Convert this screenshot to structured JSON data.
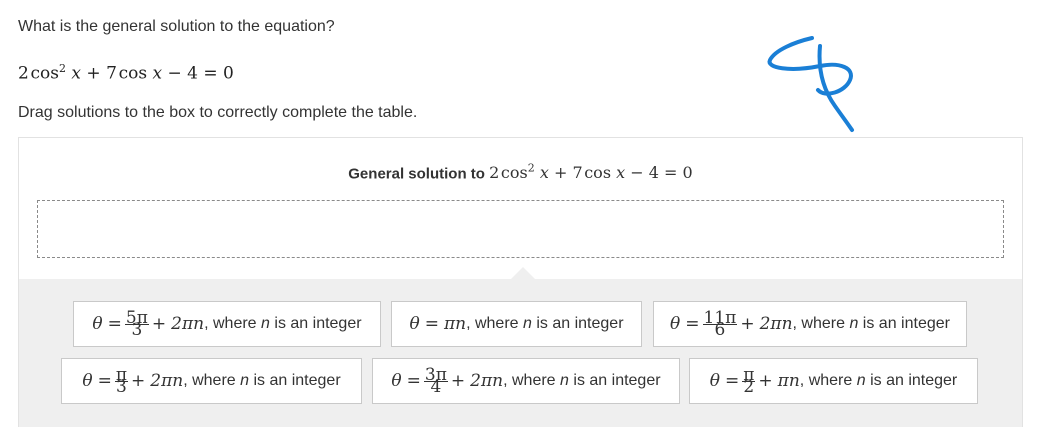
{
  "question": "What is the general solution to the equation?",
  "equation": {
    "coef_a": "2",
    "cos1": "cos",
    "exp": "2",
    "x1": "x",
    "plus": "+",
    "coef_b": "7",
    "cos2": "cos",
    "x2": "x",
    "minus": "−",
    "c": "4",
    "eq": "=",
    "rhs": "0"
  },
  "instruction": "Drag solutions to the box to correctly complete the table.",
  "table": {
    "title_text": "General solution to",
    "title_eq": {
      "coef_a": "2",
      "cos1": "cos",
      "exp": "2",
      "x1": "x",
      "plus": "+",
      "coef_b": "7",
      "cos2": "cos",
      "x2": "x",
      "minus": "−",
      "c": "4",
      "eq": "=",
      "rhs": "0"
    }
  },
  "tiles": [
    {
      "theta": "θ",
      "eq": "=",
      "num": "5π",
      "den": "3",
      "plus": "+",
      "term": "2πn",
      "tail": ", where",
      "n": "n",
      "tail2": "is an integer"
    },
    {
      "theta": "θ",
      "eq": "=",
      "term": "πn",
      "tail": ", where",
      "n": "n",
      "tail2": "is an integer"
    },
    {
      "theta": "θ",
      "eq": "=",
      "num": "11π",
      "den": "6",
      "plus": "+",
      "term": "2πn",
      "tail": ", where",
      "n": "n",
      "tail2": "is an integer"
    },
    {
      "theta": "θ",
      "eq": "=",
      "num": "π",
      "den": "3",
      "plus": "+",
      "term": "2πn",
      "tail": ", where",
      "n": "n",
      "tail2": "is an integer"
    },
    {
      "theta": "θ",
      "eq": "=",
      "num": "3π",
      "den": "4",
      "plus": "+",
      "term": "2πn",
      "tail": ", where",
      "n": "n",
      "tail2": "is an integer"
    },
    {
      "theta": "θ",
      "eq": "=",
      "num": "π",
      "den": "2",
      "plus": "+",
      "term": "πn",
      "tail": ", where",
      "n": "n",
      "tail2": "is an integer"
    }
  ],
  "colors": {
    "scribble": "#1a7fd6",
    "panel_bottom": "#efefef",
    "border": "#c9c9c9"
  },
  "icons": {
    "scribble": "handwritten-pen-mark"
  }
}
